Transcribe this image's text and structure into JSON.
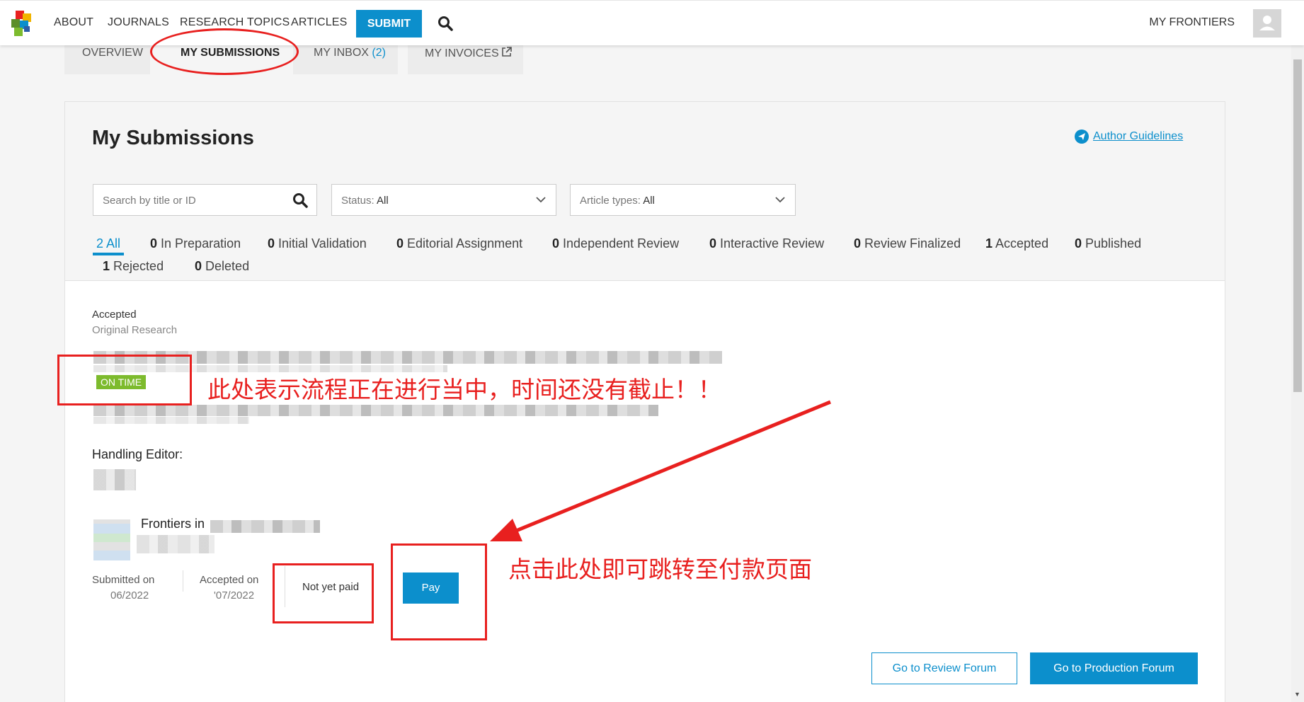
{
  "nav": {
    "items": [
      "ABOUT",
      "JOURNALS",
      "RESEARCH TOPICS",
      "ARTICLES"
    ],
    "submit_label": "SUBMIT",
    "my_frontiers": "MY FRONTIERS"
  },
  "subtabs": {
    "overview": "OVERVIEW",
    "submissions": "MY SUBMISSIONS",
    "inbox": "MY INBOX",
    "inbox_count": "(2)",
    "invoices": "MY INVOICES"
  },
  "page": {
    "title": "My Submissions",
    "guidelines": "Author Guidelines"
  },
  "search": {
    "placeholder": "Search by title or ID"
  },
  "status_select": {
    "label": "Status:",
    "value": "All"
  },
  "type_select": {
    "label": "Article types:",
    "value": "All"
  },
  "filters": [
    {
      "count": "2",
      "label": "All"
    },
    {
      "count": "0",
      "label": "In Preparation"
    },
    {
      "count": "0",
      "label": "Initial Validation"
    },
    {
      "count": "0",
      "label": "Editorial Assignment"
    },
    {
      "count": "0",
      "label": "Independent Review"
    },
    {
      "count": "0",
      "label": "Interactive Review"
    },
    {
      "count": "0",
      "label": "Review Finalized"
    },
    {
      "count": "1",
      "label": "Accepted"
    },
    {
      "count": "0",
      "label": "Published"
    },
    {
      "count": "1",
      "label": "Rejected"
    },
    {
      "count": "0",
      "label": "Deleted"
    }
  ],
  "item": {
    "status": "Accepted",
    "type": "Original Research",
    "badge": "ON TIME",
    "handling_editor_label": "Handling Editor:",
    "journal": "Frontiers in",
    "submitted_label": "Submitted on",
    "submitted_value": "06/2022",
    "accepted_label": "Accepted on",
    "accepted_value": "'07/2022",
    "payment_status": "Not yet paid",
    "pay_label": "Pay",
    "review_forum": "Go to Review Forum",
    "production_forum": "Go to Production Forum"
  },
  "annotations": {
    "ontime_note": "此处表示流程正在进行当中，时间还没有截止！！",
    "pay_note": "点击此处即可跳转至付款页面",
    "color": "#e8201f"
  },
  "colors": {
    "accent": "#0c8fcc",
    "ontime": "#7dbb2d"
  }
}
